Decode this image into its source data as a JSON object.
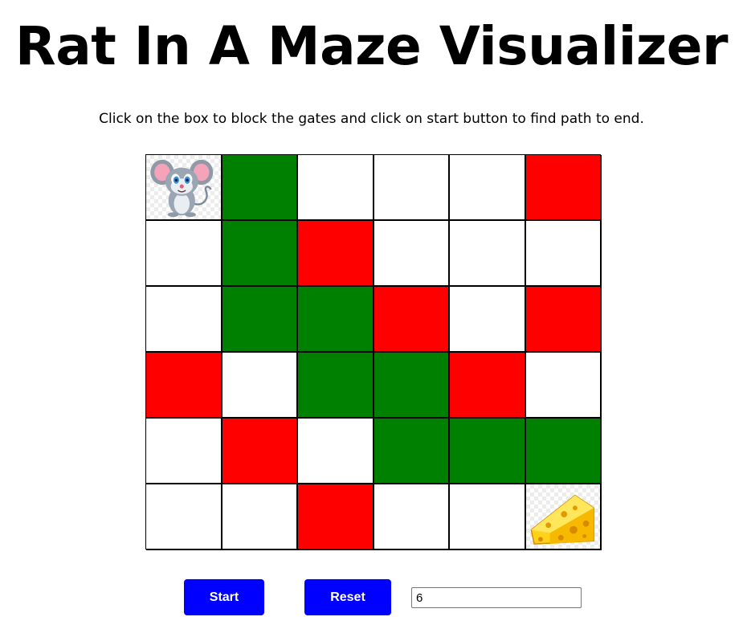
{
  "header": {
    "title": "Rat In A Maze Visualizer",
    "instructions": "Click on the box to block the gates and click on start button to find path to end."
  },
  "maze": {
    "size": 6,
    "legend_colors": {
      "open": "#ffffff",
      "blocked": "#ff0000",
      "path": "#008000"
    },
    "start_icon": "mouse-icon",
    "end_icon": "cheese-icon",
    "grid": [
      [
        "start",
        "path",
        "open",
        "open",
        "open",
        "blocked"
      ],
      [
        "open",
        "path",
        "blocked",
        "open",
        "open",
        "open"
      ],
      [
        "open",
        "path",
        "path",
        "blocked",
        "open",
        "blocked"
      ],
      [
        "blocked",
        "open",
        "path",
        "path",
        "blocked",
        "open"
      ],
      [
        "open",
        "blocked",
        "open",
        "path",
        "path",
        "path"
      ],
      [
        "open",
        "open",
        "blocked",
        "open",
        "open",
        "end"
      ]
    ]
  },
  "controls": {
    "start_label": "Start",
    "reset_label": "Reset",
    "size_value": "6",
    "button_color": "#0000ff"
  }
}
